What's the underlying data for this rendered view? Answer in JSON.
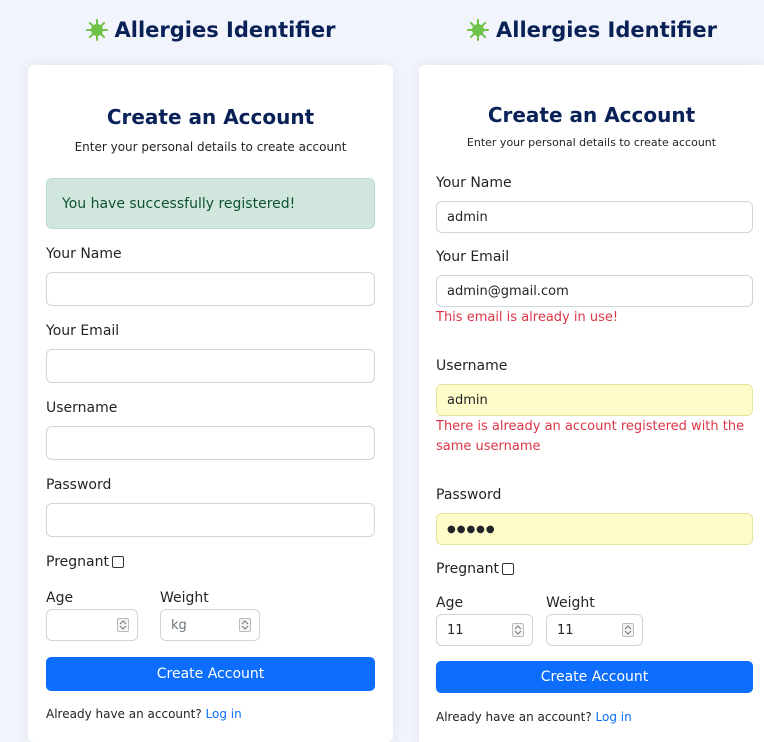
{
  "brand": {
    "name": "Allergies Identifier",
    "icon": "virus-icon",
    "color": "#0a2157",
    "icon_color": "#6ec247"
  },
  "colors": {
    "primary": "#0d6efd",
    "error": "#dc3545",
    "success_bg": "#d1e7dd",
    "success_text": "#0f5132",
    "autofill_bg": "#fefcc9"
  },
  "left": {
    "title": "Create an Account",
    "subtitle": "Enter your personal details to create account",
    "success_alert": "You have successfully registered!",
    "name_label": "Your Name",
    "email_label": "Your Email",
    "username_label": "Username",
    "password_label": "Password",
    "pregnant_label": "Pregnant",
    "age_label": "Age",
    "weight_label": "Weight",
    "weight_placeholder": "kg",
    "submit_label": "Create Account",
    "footer_text": "Already have an account?",
    "login_link": "Log in"
  },
  "right": {
    "title": "Create an Account",
    "subtitle": "Enter your personal details to create account",
    "name_label": "Your Name",
    "name_value": "admin",
    "email_label": "Your Email",
    "email_value": "admin@gmail.com",
    "email_error": "This email is already in use!",
    "username_label": "Username",
    "username_value": "admin",
    "username_error": "There is already an account registered with the same username",
    "password_label": "Password",
    "password_value": "●●●●●",
    "pregnant_label": "Pregnant",
    "age_label": "Age",
    "age_value": "11",
    "weight_label": "Weight",
    "weight_value": "11",
    "submit_label": "Create Account",
    "footer_text": "Already have an account?",
    "login_link": "Log in"
  }
}
